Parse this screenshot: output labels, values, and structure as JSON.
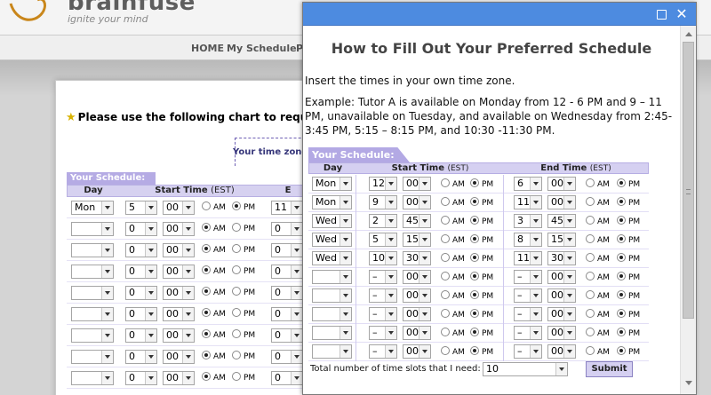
{
  "site": {
    "logo_text": "brainfuse",
    "tagline": "ignite your mind",
    "nav": [
      "HOME",
      "My Schedule",
      "P"
    ]
  },
  "background": {
    "title": "Please use the following chart to reque",
    "timezone_label": "Your time zone",
    "schedule_label": "Your Schedule:",
    "headers": {
      "day": "Day",
      "start": "Start Time",
      "unit": "(EST)",
      "end": "E"
    },
    "rows": [
      {
        "day": "Mon",
        "hour": "5",
        "min": "00",
        "ampm": "PM",
        "end_hour": "11"
      },
      {
        "day": "",
        "hour": "0",
        "min": "00",
        "ampm": "AM",
        "end_hour": "0"
      },
      {
        "day": "",
        "hour": "0",
        "min": "00",
        "ampm": "AM",
        "end_hour": "0"
      },
      {
        "day": "",
        "hour": "0",
        "min": "00",
        "ampm": "AM",
        "end_hour": "0"
      },
      {
        "day": "",
        "hour": "0",
        "min": "00",
        "ampm": "AM",
        "end_hour": "0"
      },
      {
        "day": "",
        "hour": "0",
        "min": "00",
        "ampm": "AM",
        "end_hour": "0"
      },
      {
        "day": "",
        "hour": "0",
        "min": "00",
        "ampm": "AM",
        "end_hour": "0"
      },
      {
        "day": "",
        "hour": "0",
        "min": "00",
        "ampm": "AM",
        "end_hour": "0"
      },
      {
        "day": "",
        "hour": "0",
        "min": "00",
        "ampm": "AM",
        "end_hour": "0"
      }
    ]
  },
  "modal": {
    "title": "How to Fill Out Your Preferred Schedule",
    "instruction": "Insert the times in your own time zone.",
    "example": "Example: Tutor A is available on Monday from 12 - 6 PM and 9 – 11 PM, unavailable on Tuesday, and available on Wednesday from 2:45-3:45 PM, 5:15 – 8:15 PM, and 10:30 -11:30 PM.",
    "schedule_label": "Your Schedule:",
    "headers": {
      "day": "Day",
      "start": "Start Time",
      "end": "End Time",
      "unit": "(EST)"
    },
    "am_label": "AM",
    "pm_label": "PM",
    "rows": [
      {
        "day": "Mon",
        "start_hour": "12",
        "start_min": "00",
        "start_ampm": "PM",
        "end_hour": "6",
        "end_min": "00",
        "end_ampm": "PM"
      },
      {
        "day": "Mon",
        "start_hour": "9",
        "start_min": "00",
        "start_ampm": "PM",
        "end_hour": "11",
        "end_min": "00",
        "end_ampm": "PM"
      },
      {
        "day": "Wed",
        "start_hour": "2",
        "start_min": "45",
        "start_ampm": "PM",
        "end_hour": "3",
        "end_min": "45",
        "end_ampm": "PM"
      },
      {
        "day": "Wed",
        "start_hour": "5",
        "start_min": "15",
        "start_ampm": "PM",
        "end_hour": "8",
        "end_min": "15",
        "end_ampm": "PM"
      },
      {
        "day": "Wed",
        "start_hour": "10",
        "start_min": "30",
        "start_ampm": "PM",
        "end_hour": "11",
        "end_min": "30",
        "end_ampm": "PM"
      },
      {
        "day": "",
        "start_hour": "–",
        "start_min": "00",
        "start_ampm": "PM",
        "end_hour": "–",
        "end_min": "00",
        "end_ampm": "PM"
      },
      {
        "day": "",
        "start_hour": "–",
        "start_min": "00",
        "start_ampm": "PM",
        "end_hour": "–",
        "end_min": "00",
        "end_ampm": "PM"
      },
      {
        "day": "",
        "start_hour": "–",
        "start_min": "00",
        "start_ampm": "PM",
        "end_hour": "–",
        "end_min": "00",
        "end_ampm": "PM"
      },
      {
        "day": "",
        "start_hour": "–",
        "start_min": "00",
        "start_ampm": "PM",
        "end_hour": "–",
        "end_min": "00",
        "end_ampm": "PM"
      },
      {
        "day": "",
        "start_hour": "–",
        "start_min": "00",
        "start_ampm": "PM",
        "end_hour": "–",
        "end_min": "00",
        "end_ampm": "PM"
      }
    ],
    "slots_label": "Total number of time slots that I need:",
    "slots_value": "10",
    "submit_label": "Submit"
  },
  "colors": {
    "accent": "#4d8be0",
    "schedule_purple": "#b3a9e4",
    "header_lavender": "#d5d0f1"
  }
}
